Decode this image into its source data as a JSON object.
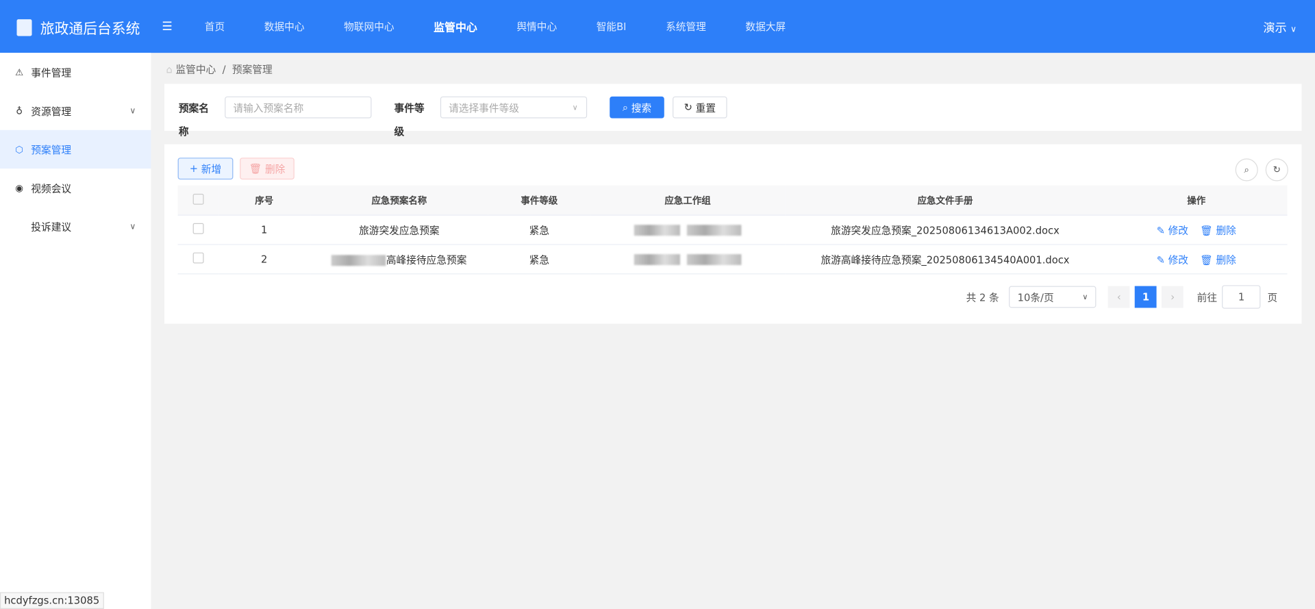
{
  "app": {
    "title": "旅政通后台系统",
    "user": "演示"
  },
  "nav": [
    "首页",
    "数据中心",
    "物联网中心",
    "监管中心",
    "舆情中心",
    "智能BI",
    "系统管理",
    "数据大屏"
  ],
  "sidebar": [
    {
      "label": "事件管理",
      "icon": "alarm-icon"
    },
    {
      "label": "资源管理",
      "icon": "bell-icon"
    },
    {
      "label": "预案管理",
      "icon": "cube-icon"
    },
    {
      "label": "视频会议",
      "icon": "play-icon"
    },
    {
      "label": "投诉建议",
      "icon": ""
    }
  ],
  "breadcrumb": [
    "监管中心",
    "预案管理"
  ],
  "filter": {
    "name_label": "预案名称",
    "name_placeholder": "请输入预案名称",
    "level_label": "事件等级",
    "level_placeholder": "请选择事件等级",
    "search": "搜索",
    "reset": "重置"
  },
  "toolbar": {
    "add": "新增",
    "delete": "删除"
  },
  "table": {
    "headers": [
      "序号",
      "应急预案名称",
      "事件等级",
      "应急工作组",
      "应急文件手册",
      "操作"
    ],
    "rows": [
      {
        "no": "1",
        "name": "旅游突发应急预案",
        "level": "紧急",
        "file": "旅游突发应急预案_20250806134613A002.docx"
      },
      {
        "no": "2",
        "name": "高峰接待应急预案",
        "level": "紧急",
        "file": "旅游高峰接待应急预案_20250806134540A001.docx"
      }
    ],
    "edit": "修改",
    "remove": "删除"
  },
  "pagination": {
    "total": "共 2 条",
    "page_size": "10条/页",
    "current": "1",
    "goto": "前往",
    "goto_value": "1",
    "page_suffix": "页"
  },
  "status_url": "hcdyfzgs.cn:13085"
}
